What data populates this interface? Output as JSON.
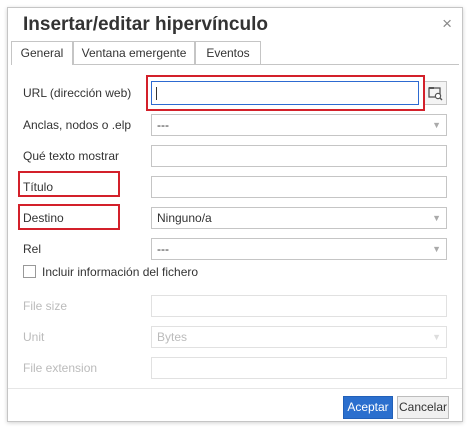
{
  "dialog": {
    "title": "Insertar/editar hipervínculo",
    "close_glyph": "×"
  },
  "tabs": [
    {
      "label": "General",
      "active": true
    },
    {
      "label": "Ventana emergente",
      "active": false
    },
    {
      "label": "Eventos",
      "active": false
    }
  ],
  "form": {
    "url_label": "URL (dirección web)",
    "url_value": "",
    "anchors_label": "Anclas, nodos o .elp",
    "anchors_value": "---",
    "text_label": "Qué texto mostrar",
    "text_value": "",
    "title_label": "Título",
    "title_value": "",
    "target_label": "Destino",
    "target_value": "Ninguno/a",
    "rel_label": "Rel",
    "rel_value": "---",
    "include_file_info_label": "Incluir información del fichero",
    "include_file_info_checked": false,
    "file_size_label": "File size",
    "file_size_value": "",
    "unit_label": "Unit",
    "unit_value": "Bytes",
    "file_extension_label": "File extension",
    "file_extension_value": ""
  },
  "buttons": {
    "ok_label": "Aceptar",
    "cancel_label": "Cancelar"
  },
  "icons": {
    "close": "close-icon",
    "browse": "folder-search-icon",
    "dropdown": "chevron-down-icon"
  },
  "colors": {
    "accent": "#2b6fce",
    "highlight": "#d3202a"
  }
}
